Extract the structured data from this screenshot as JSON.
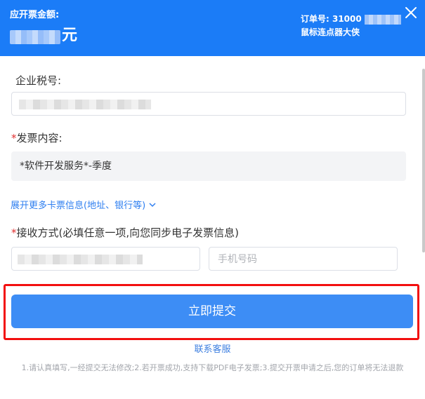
{
  "header": {
    "amount_title": "应开票金额:",
    "amount_unit": "元",
    "order_label": "订单号: 31000",
    "product_name": "鼠标连点器大侠"
  },
  "form": {
    "tax_id": {
      "label": "企业税号:"
    },
    "invoice_content": {
      "required_mark": "*",
      "label": "发票内容:",
      "value": "*软件开发服务*-季度"
    },
    "expand_link": "展开更多卡票信息(地址、银行等)",
    "receive": {
      "required_mark": "*",
      "label": "接收方式(必填任意一项,向您同步电子发票信息)",
      "phone_placeholder": "手机号码"
    }
  },
  "submit_label": "立即提交",
  "contact_label": "联系客服",
  "notice": "1.请认真填写,一经提交无法修改;2.若开票成功,支持下载PDF电子发票;3.提交开票申请之后,您的订单将无法退款",
  "colors": {
    "header_bg": "#1b7cf7",
    "button_bg": "#3d8df5",
    "link": "#2f7ff0",
    "required": "#e03030",
    "highlight": "#f20f0f"
  }
}
